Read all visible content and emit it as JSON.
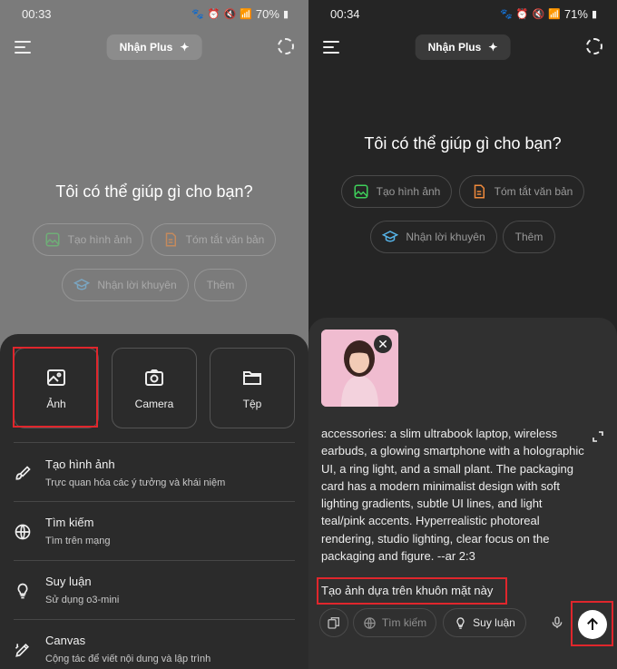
{
  "left": {
    "status": {
      "time": "00:33",
      "battery": "70%"
    },
    "plus_label": "Nhận Plus",
    "headline": "Tôi có thể giúp gì cho bạn?",
    "chips": [
      "Tạo hình ảnh",
      "Tóm tắt văn bản",
      "Nhận lời khuyên",
      "Thêm"
    ],
    "tiles": [
      "Ảnh",
      "Camera",
      "Tệp"
    ],
    "items": [
      {
        "title": "Tạo hình ảnh",
        "sub": "Trực quan hóa các ý tưởng và khái niệm",
        "icon": "brush-icon"
      },
      {
        "title": "Tìm kiếm",
        "sub": "Tìm trên mạng",
        "icon": "globe-icon"
      },
      {
        "title": "Suy luận",
        "sub": "Sử dụng o3-mini",
        "icon": "lightbulb-icon"
      },
      {
        "title": "Canvas",
        "sub": "Cộng tác để viết nội dung và lập trình",
        "icon": "pen-icon"
      }
    ]
  },
  "right": {
    "status": {
      "time": "00:34",
      "battery": "71%"
    },
    "plus_label": "Nhận Plus",
    "headline": "Tôi có thể giúp gì cho bạn?",
    "chips": [
      "Tạo hình ảnh",
      "Tóm tắt văn bản",
      "Nhận lời khuyên",
      "Thêm"
    ],
    "prompt_text": "accessories: a slim ultrabook laptop, wireless earbuds, a glowing smartphone with a holographic UI, a ring light, and a small plant. The packaging card has a modern minimalist design with soft lighting gradients, subtle UI lines, and light teal/pink accents. Hyperrealistic photoreal rendering, studio lighting, clear focus on the packaging and figure. --ar 2:3",
    "input_text": "Tạo ảnh dựa trên khuôn mặt này",
    "toolbar": {
      "search": "Tìm kiếm",
      "reason": "Suy luận"
    }
  },
  "colors": {
    "highlight": "#e0262c",
    "green": "#3ecf5a",
    "orange": "#f08a3c",
    "blue": "#56b4e9"
  }
}
